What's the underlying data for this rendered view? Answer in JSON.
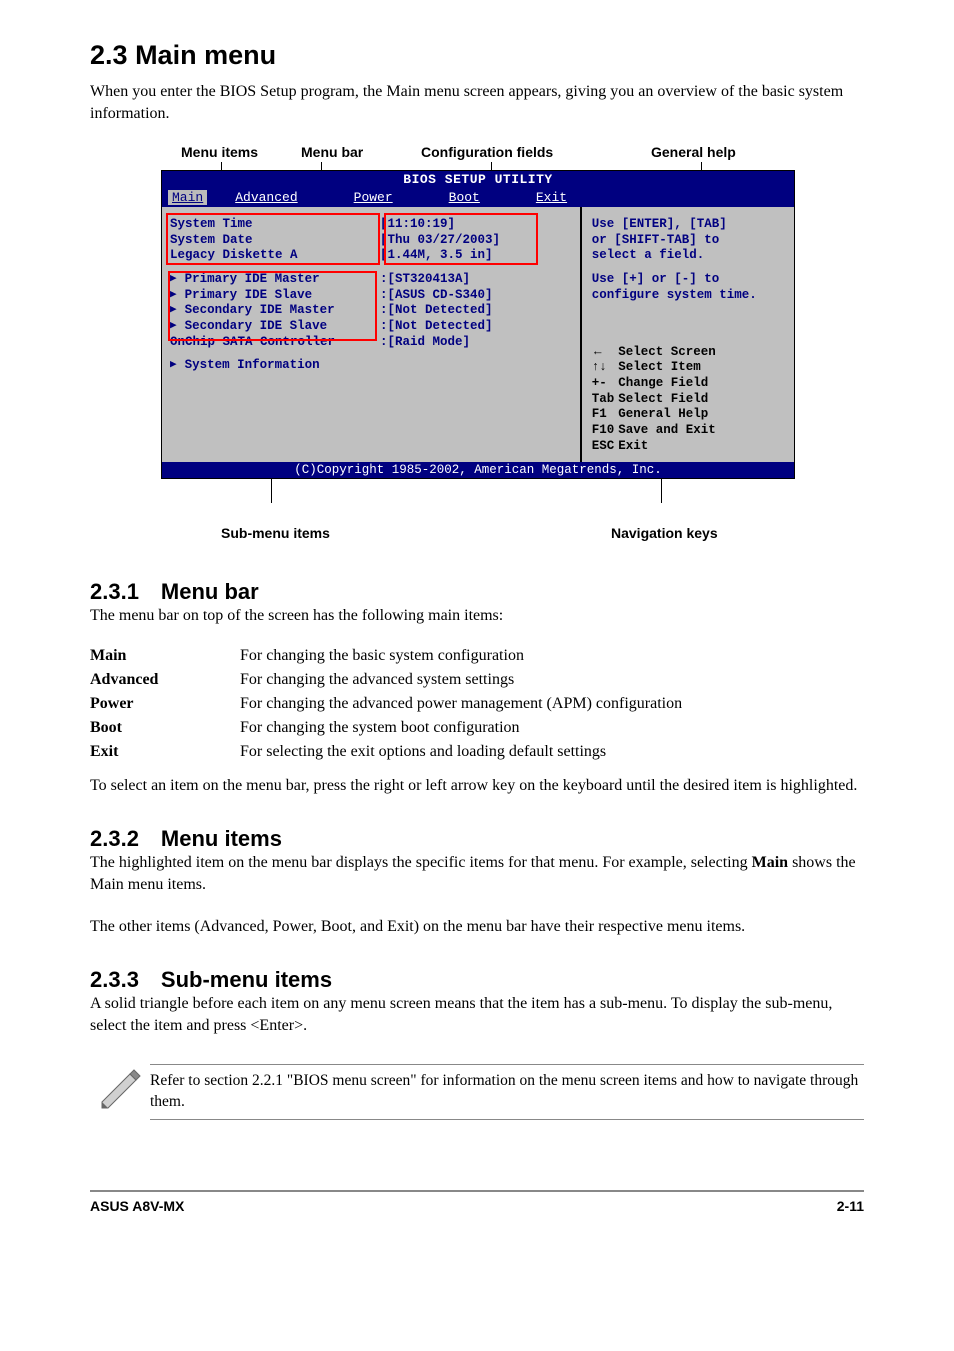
{
  "section": {
    "number": "2.3",
    "title": "Main menu",
    "intro": "When you enter the BIOS Setup program, the Main menu screen appears, giving you an overview of the basic system information."
  },
  "bios": {
    "title": "BIOS SETUP UTILITY",
    "menu": {
      "main": "Main",
      "advanced": "Advanced",
      "power": "Power",
      "boot": "Boot",
      "exit": "Exit"
    },
    "fields": {
      "system_time_label": "System Time",
      "system_time_value": "[11:10:19]",
      "system_date_label": "System Date",
      "system_date_value": "[Thu 03/27/2003]",
      "legacy_diskette_label": "Legacy Diskette A",
      "legacy_diskette_value": "[1.44M, 3.5 in]",
      "primary_master_label": "Primary IDE Master",
      "primary_master_value": ":[ST320413A]",
      "primary_slave_label": "Primary IDE Slave",
      "primary_slave_value": ":[ASUS CD-S340]",
      "secondary_master_label": "Secondary IDE Master",
      "secondary_master_value": ":[Not Detected]",
      "secondary_slave_label": "Secondary IDE Slave",
      "secondary_slave_value": ":[Not Detected]",
      "sata_label": "OnChip SATA Controller",
      "sata_value": ":[Raid Mode]",
      "sysinfo_label": "System Information"
    },
    "help": {
      "line1": "Use [ENTER], [TAB]",
      "line2": "or [SHIFT-TAB] to",
      "line3": "select a field.",
      "line4": "Use [+] or [-] to",
      "line5": "configure system time."
    },
    "nav": {
      "select_screen": "Select Screen",
      "select_item": "Select Item",
      "change_field": "Change Field",
      "select_field": "Select Field",
      "general_help": "General Help",
      "save_exit": "Save and Exit",
      "exit": "Exit",
      "k_plusminus": "+-",
      "k_tab": "Tab",
      "k_f1": "F1",
      "k_f10": "F10",
      "k_esc": "ESC"
    },
    "copyright": "(C)Copyright 1985-2002, American Megatrends, Inc."
  },
  "callouts": {
    "menu_items": "Menu items",
    "menu_bar": "Menu bar",
    "config_fields": "Configuration fields",
    "general_help": "General help",
    "submenu_items": "Sub-menu items",
    "nav_keys": "Navigation keys"
  },
  "menu_bar_section": {
    "title": "2.3.1 Menu bar",
    "intro": "The menu bar on top of the screen has the following main items:",
    "items": [
      {
        "name": "Main",
        "desc": "For changing the basic system configuration"
      },
      {
        "name": "Advanced",
        "desc": "For changing the advanced system settings"
      },
      {
        "name": "Power",
        "desc": "For changing the advanced power management (APM) configuration"
      },
      {
        "name": "Boot",
        "desc": "For changing the system boot configuration"
      },
      {
        "name": "Exit",
        "desc": "For selecting the exit options and loading default settings"
      }
    ],
    "closing": "To select an item on the menu bar, press the right or left arrow key on the keyboard until the desired item is highlighted."
  },
  "menu_items_section": {
    "title": "2.3.2 Menu items",
    "p1a": "The highlighted item on the menu bar displays the specific items for that menu. For example, selecting ",
    "p1b": "Main",
    "p1c": " shows the Main menu items.",
    "p2": "The other items (Advanced, Power, Boot, and Exit) on the menu bar have their respective menu items."
  },
  "submenu_section": {
    "title": "2.3.3 Sub-menu items",
    "p": "A solid triangle before each item on any menu screen means that the item has a sub-menu. To display the sub-menu, select the item and press <Enter>."
  },
  "note": {
    "text": "Refer to section 2.2.1 \"BIOS menu screen\" for information on the menu screen items and how to navigate through them."
  },
  "footer": {
    "left": "ASUS A8V-MX",
    "right": "2-11"
  }
}
